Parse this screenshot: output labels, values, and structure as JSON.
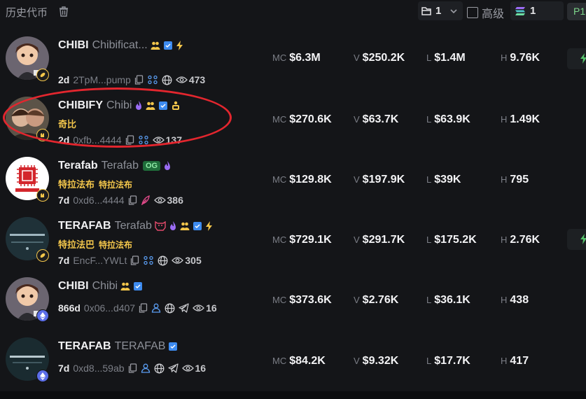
{
  "header": {
    "title": "历史代币",
    "folder_count": "1",
    "advanced_label": "高级",
    "sol_count": "1",
    "page_label": "P1"
  },
  "labels": {
    "mc": "MC",
    "v": "V",
    "l": "L",
    "h": "H"
  },
  "tokens": [
    {
      "ticker": "CHIBI",
      "name": "Chibificat...",
      "cn": [],
      "age": "2d",
      "address": "2TpM...pump",
      "views": "473",
      "mc": "$6.3M",
      "v": "$250.2K",
      "l": "$1.4M",
      "h": "9.76K"
    },
    {
      "ticker": "CHIBIFY",
      "name": "Chibi",
      "cn": [
        "奇比"
      ],
      "age": "2d",
      "address": "0xfb...4444",
      "views": "137",
      "mc": "$270.6K",
      "v": "$63.7K",
      "l": "$63.9K",
      "h": "1.49K"
    },
    {
      "ticker": "Terafab",
      "name": "Terafab",
      "og": "OG",
      "cn": [
        "特拉法布",
        "特拉法布"
      ],
      "age": "7d",
      "address": "0xd6...4444",
      "views": "386",
      "mc": "$129.8K",
      "v": "$197.9K",
      "l": "$39K",
      "h": "795"
    },
    {
      "ticker": "TERAFAB",
      "name": "Terafab",
      "cn": [
        "特拉法巴",
        "特拉法布"
      ],
      "age": "7d",
      "address": "EncF...YWLt",
      "views": "305",
      "mc": "$729.1K",
      "v": "$291.7K",
      "l": "$175.2K",
      "h": "2.76K"
    },
    {
      "ticker": "CHIBI",
      "name": "Chibi",
      "cn": [],
      "age": "866d",
      "address": "0x06...d407",
      "views": "16",
      "mc": "$373.6K",
      "v": "$2.76K",
      "l": "$36.1K",
      "h": "438"
    },
    {
      "ticker": "TERAFAB",
      "name": "TERAFAB",
      "cn": [],
      "age": "7d",
      "address": "0xd8...59ab",
      "views": "16",
      "mc": "$84.2K",
      "v": "$9.32K",
      "l": "$17.7K",
      "h": "417"
    }
  ]
}
